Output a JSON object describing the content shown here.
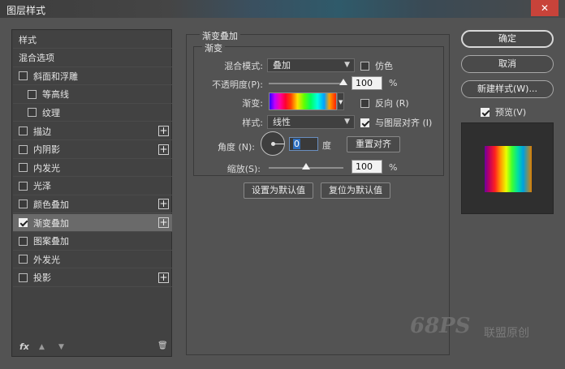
{
  "window": {
    "title": "图层样式",
    "close_label": "✕"
  },
  "left_panel": {
    "items": [
      {
        "label": "样式",
        "has_checkbox": false,
        "checked": false,
        "has_plus": false,
        "indent": 0
      },
      {
        "label": "混合选项",
        "has_checkbox": false,
        "checked": false,
        "has_plus": false,
        "indent": 0
      },
      {
        "label": "斜面和浮雕",
        "has_checkbox": true,
        "checked": false,
        "has_plus": false,
        "indent": 0
      },
      {
        "label": "等高线",
        "has_checkbox": true,
        "checked": false,
        "has_plus": false,
        "indent": 1
      },
      {
        "label": "纹理",
        "has_checkbox": true,
        "checked": false,
        "has_plus": false,
        "indent": 1
      },
      {
        "label": "描边",
        "has_checkbox": true,
        "checked": false,
        "has_plus": true,
        "indent": 0
      },
      {
        "label": "内阴影",
        "has_checkbox": true,
        "checked": false,
        "has_plus": true,
        "indent": 0
      },
      {
        "label": "内发光",
        "has_checkbox": true,
        "checked": false,
        "has_plus": false,
        "indent": 0
      },
      {
        "label": "光泽",
        "has_checkbox": true,
        "checked": false,
        "has_plus": false,
        "indent": 0
      },
      {
        "label": "颜色叠加",
        "has_checkbox": true,
        "checked": false,
        "has_plus": true,
        "indent": 0
      },
      {
        "label": "渐变叠加",
        "has_checkbox": true,
        "checked": true,
        "has_plus": true,
        "indent": 0,
        "active": true
      },
      {
        "label": "图案叠加",
        "has_checkbox": true,
        "checked": false,
        "has_plus": false,
        "indent": 0
      },
      {
        "label": "外发光",
        "has_checkbox": true,
        "checked": false,
        "has_plus": false,
        "indent": 0
      },
      {
        "label": "投影",
        "has_checkbox": true,
        "checked": false,
        "has_plus": true,
        "indent": 0
      }
    ],
    "footer": {
      "fx_label": "fx",
      "up_icon": "▲",
      "down_icon": "▼",
      "trash_icon": "🗑"
    }
  },
  "gradient_overlay": {
    "section_title": "渐变叠加",
    "group_title": "渐变",
    "blend_mode_label": "混合模式:",
    "blend_mode_value": "叠加",
    "dither_label": "仿色",
    "dither_checked": false,
    "opacity_label": "不透明度(P):",
    "opacity_value": "100",
    "opacity_level": 1.0,
    "percent": "%",
    "gradient_label": "渐变:",
    "reverse_label": "反向 (R)",
    "reverse_checked": false,
    "style_label": "样式:",
    "style_value": "线性",
    "align_label": "与图层对齐 (I)",
    "align_checked": true,
    "angle_label": "角度 (N):",
    "angle_value": "0",
    "angle_unit": "度",
    "reset_align_label": "重置对齐",
    "scale_label": "缩放(S):",
    "scale_value": "100",
    "scale_level": 0.5,
    "set_default_label": "设置为默认值",
    "reset_default_label": "复位为默认值"
  },
  "right_panel": {
    "ok_label": "确定",
    "cancel_label": "取消",
    "new_style_label": "新建样式(W)...",
    "preview_label": "预览(V)",
    "preview_checked": true
  },
  "watermark": {
    "logo": "68PS",
    "text": "联盟原创"
  }
}
